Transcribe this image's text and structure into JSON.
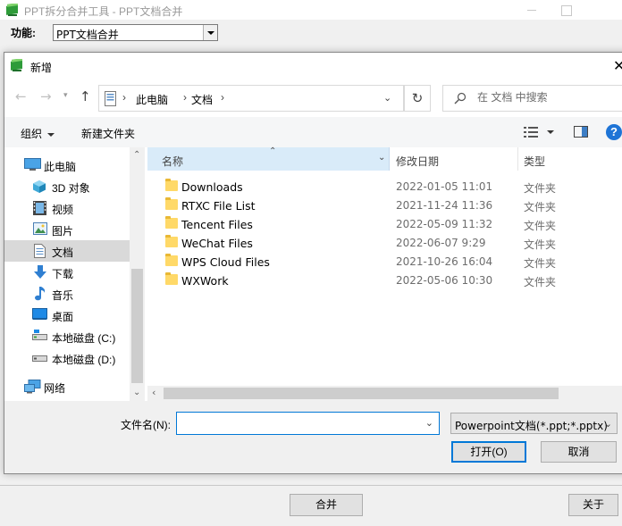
{
  "app": {
    "title": "PPT拆分合并工具 - PPT文档合并",
    "function_label": "功能:",
    "function_value": "PPT文档合并",
    "merge_button": "合并",
    "about_button": "关于"
  },
  "dialog": {
    "title": "新增",
    "breadcrumb": [
      "此电脑",
      "文档"
    ],
    "search_placeholder": "在 文档 中搜索",
    "toolbar": {
      "organize": "组织",
      "new_folder": "新建文件夹"
    },
    "sidebar": [
      {
        "label": "此电脑",
        "icon": "pc-icon",
        "selected": false
      },
      {
        "label": "3D 对象",
        "icon": "3d-objects-icon",
        "selected": false
      },
      {
        "label": "视频",
        "icon": "video-icon",
        "selected": false
      },
      {
        "label": "图片",
        "icon": "pictures-icon",
        "selected": false
      },
      {
        "label": "文档",
        "icon": "documents-icon",
        "selected": true
      },
      {
        "label": "下载",
        "icon": "download-icon",
        "selected": false
      },
      {
        "label": "音乐",
        "icon": "music-icon",
        "selected": false
      },
      {
        "label": "桌面",
        "icon": "desktop-icon",
        "selected": false
      },
      {
        "label": "本地磁盘 (C:)",
        "icon": "drive-icon",
        "selected": false
      },
      {
        "label": "本地磁盘 (D:)",
        "icon": "drive-icon",
        "selected": false
      },
      {
        "label": "网络",
        "icon": "network-icon",
        "selected": false
      }
    ],
    "columns": {
      "name": "名称",
      "date": "修改日期",
      "type": "类型"
    },
    "files": [
      {
        "name": "Downloads",
        "date": "2022-01-05 11:01",
        "type": "文件夹"
      },
      {
        "name": "RTXC File List",
        "date": "2021-11-24 11:36",
        "type": "文件夹"
      },
      {
        "name": "Tencent Files",
        "date": "2022-05-09 11:32",
        "type": "文件夹"
      },
      {
        "name": "WeChat Files",
        "date": "2022-06-07 9:29",
        "type": "文件夹"
      },
      {
        "name": "WPS Cloud Files",
        "date": "2021-10-26 16:04",
        "type": "文件夹"
      },
      {
        "name": "WXWork",
        "date": "2022-05-06 10:30",
        "type": "文件夹"
      }
    ],
    "filename_label": "文件名(N):",
    "filename_value": "",
    "filetype_value": "Powerpoint文档(*.ppt;*.pptx)",
    "open_button": "打开(O)",
    "cancel_button": "取消"
  },
  "colors": {
    "accent": "#0078d7",
    "selected_bg": "#d9d9d9",
    "header_highlight": "#d9ebf9",
    "folder": "#ffd968"
  }
}
